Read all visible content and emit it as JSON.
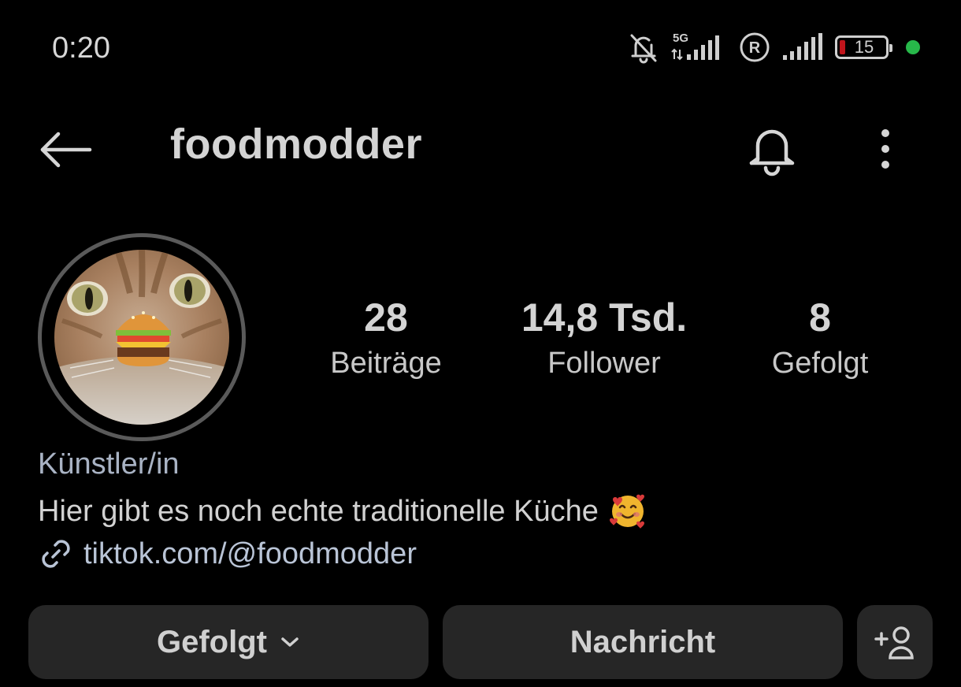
{
  "status_bar": {
    "time": "0:20",
    "network_label": "5G",
    "battery_level": "15",
    "battery_color": "#c0141b",
    "dot_color": "#27b84a",
    "icons": [
      "bell-off-icon",
      "signal-5g-icon",
      "registered-icon",
      "signal-icon",
      "battery-icon",
      "privacy-dot-icon"
    ]
  },
  "header": {
    "username": "foodmodder",
    "icons": [
      "arrow-left-icon",
      "bell-icon",
      "more-vertical-icon"
    ]
  },
  "profile": {
    "avatar_icon": "cat-with-burger-avatar",
    "stats": [
      {
        "value": "28",
        "label": "Beiträge"
      },
      {
        "value": "14,8 Tsd.",
        "label": "Follower"
      },
      {
        "value": "8",
        "label": "Gefolgt"
      }
    ],
    "bio": {
      "category": "Künstler/in",
      "text": "Hier gibt es noch echte traditionelle Küche",
      "emoji_icon": "smiling-face-with-hearts-icon",
      "link": "tiktok.com/@foodmodder",
      "link_icon": "link-icon"
    }
  },
  "actions": {
    "follow_label": "Gefolgt",
    "follow_icon": "chevron-down-icon",
    "message_label": "Nachricht",
    "add_user_icon": "add-user-icon"
  }
}
